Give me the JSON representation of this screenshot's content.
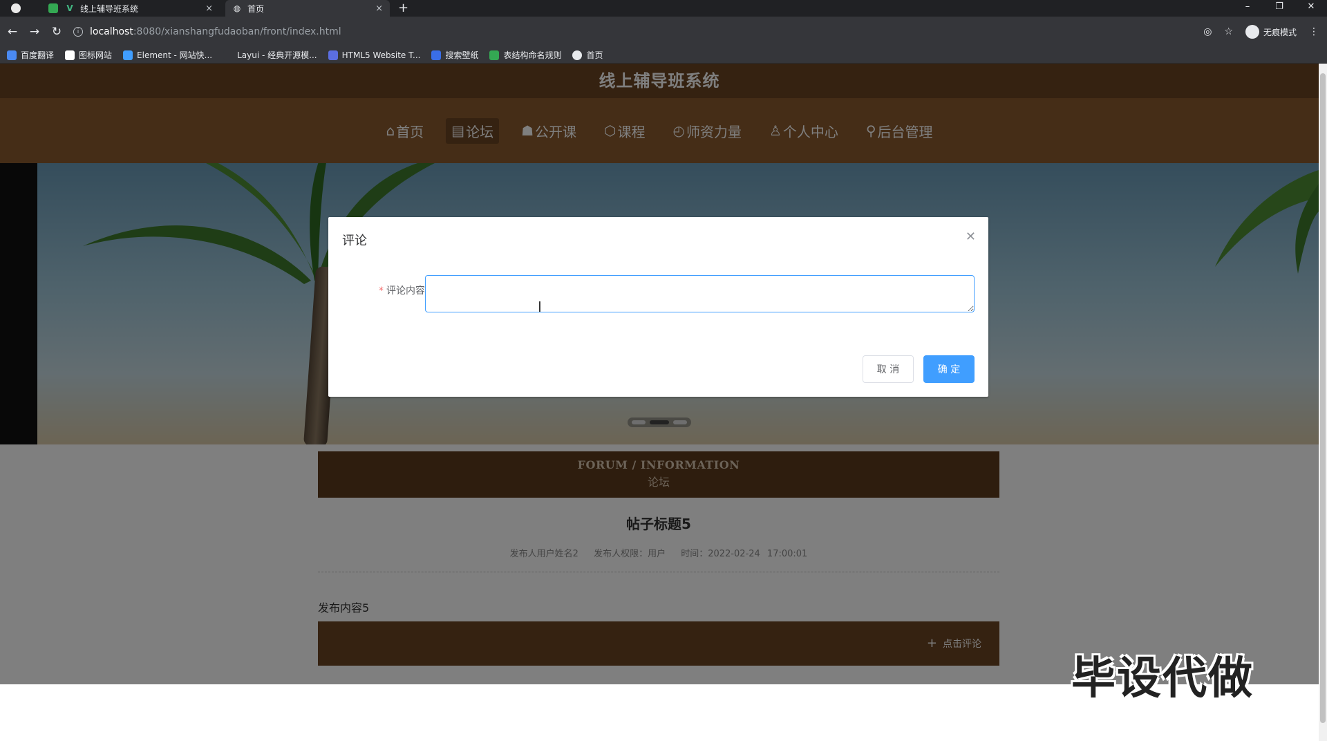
{
  "browser": {
    "tabs": [
      {
        "label": "线上辅导班系统"
      },
      {
        "label": "首页"
      }
    ],
    "tab_close": "×",
    "new_tab": "+",
    "url_host": "localhost",
    "url_path": ":8080/xianshangfudaoban/front/index.html",
    "incognito_label": "无痕模式",
    "bookmarks": [
      {
        "label": "百度翻译"
      },
      {
        "label": "图标网站"
      },
      {
        "label": "Element - 网站快..."
      },
      {
        "label": "Layui - 经典开源模..."
      },
      {
        "label": "HTML5 Website T..."
      },
      {
        "label": "搜索壁纸"
      },
      {
        "label": "表结构命名规则"
      },
      {
        "label": "首页"
      }
    ]
  },
  "site": {
    "title": "线上辅导班系统",
    "nav": [
      {
        "icon": "⌂",
        "label": "首页"
      },
      {
        "icon": "▤",
        "label": "论坛"
      },
      {
        "icon": "☗",
        "label": "公开课"
      },
      {
        "icon": "⬡",
        "label": "课程"
      },
      {
        "icon": "◴",
        "label": "师资力量"
      },
      {
        "icon": "♙",
        "label": "个人中心"
      },
      {
        "icon": "⚲",
        "label": "后台管理"
      }
    ]
  },
  "forum": {
    "heading_en": "FORUM / INFORMATION",
    "heading_cn": "论坛"
  },
  "post": {
    "title": "帖子标题5",
    "author": "发布人用户姓名2",
    "role": "发布人权限：用户",
    "time": "时间：2022-02-24 17:00:01",
    "content": "发布内容5",
    "comment_button": "点击评论"
  },
  "dialog": {
    "title": "评论",
    "field_label": "评论内容",
    "field_required": "*",
    "field_value": "",
    "cancel": "取 消",
    "confirm": "确 定"
  },
  "watermark": "毕设代做"
}
